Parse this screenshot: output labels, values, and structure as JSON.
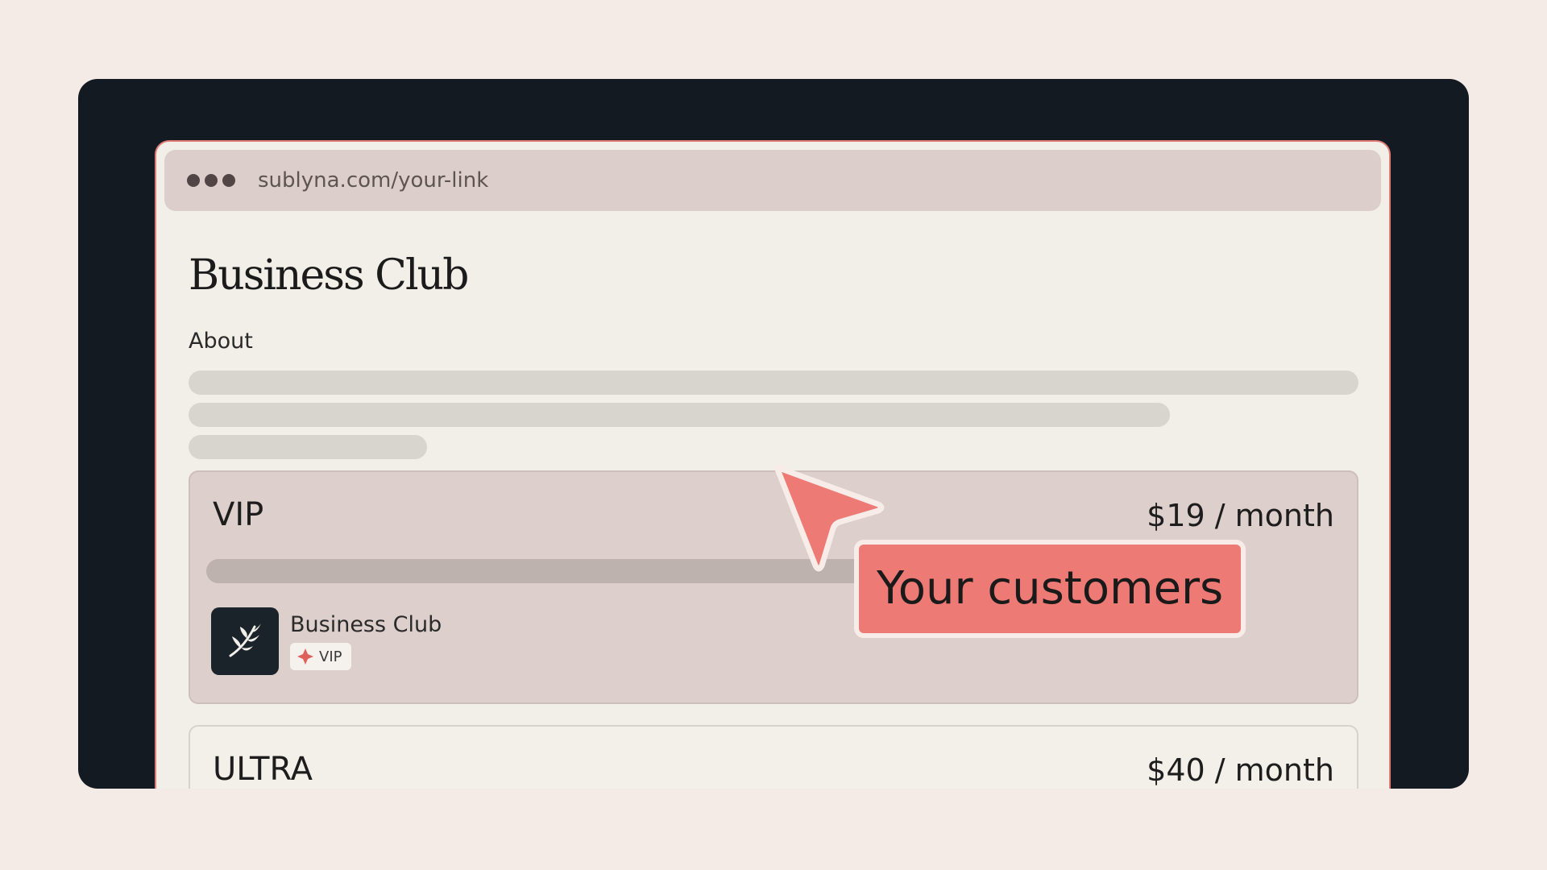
{
  "browser": {
    "url": "sublyna.com/your-link",
    "dots_icon": "window-dots-icon"
  },
  "page": {
    "title": "Business Club",
    "about_label": "About"
  },
  "tiers": [
    {
      "name": "VIP",
      "price": "$19 / month",
      "club_name": "Business Club",
      "badge_label": "VIP",
      "logo_icon": "laurel-branch-icon",
      "badge_icon": "sparkle-icon"
    },
    {
      "name": "ULTRA",
      "price": "$40 / month"
    }
  ],
  "overlay": {
    "cursor_icon": "pointer-cursor-icon",
    "tooltip": "Your customers"
  },
  "colors": {
    "background": "#f5ebe6",
    "frame": "#131a21",
    "accent": "#ee7a75",
    "address_bar": "#dccfcb",
    "page": "#f2efe8"
  }
}
